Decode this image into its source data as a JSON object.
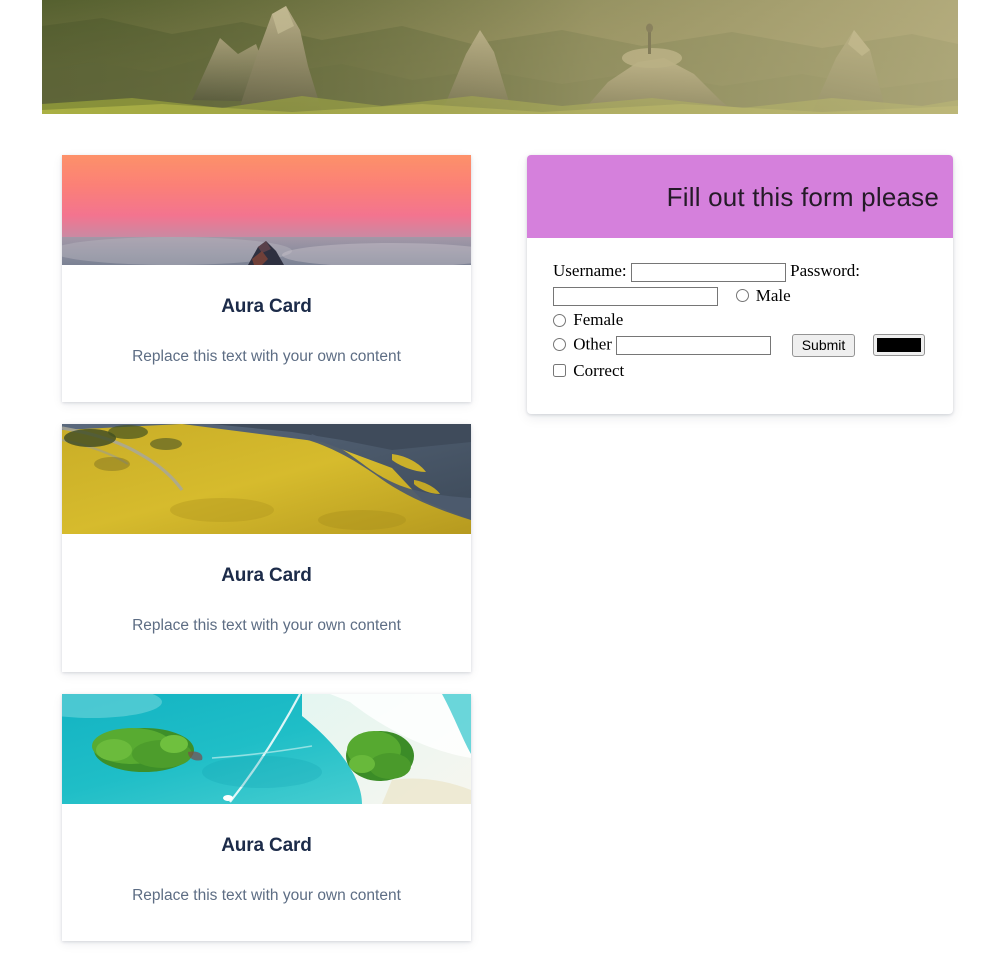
{
  "hero": {
    "alt": "mountain-landscape-banner",
    "palette": {
      "sky": "#8a8457",
      "forest": "#4f5a30",
      "rock_light": "#b3a882",
      "rock_dark": "#6a6348",
      "highlight": "#c9d14a"
    }
  },
  "cards": [
    {
      "title": "Aura Card",
      "text": "Replace this text with your own content",
      "image_name": "pink-sunset-peak-photo",
      "palette": {
        "top": "#fb8b6e",
        "mid": "#f4758f",
        "low": "#c98a9f",
        "bottom": "#6c7285",
        "accent": "#2f3242"
      }
    },
    {
      "title": "Aura Card",
      "text": "Replace this text with your own content",
      "image_name": "aerial-golden-grassland-river-photo",
      "palette": {
        "grass": "#d0b32a",
        "grass_dark": "#8a7c1e",
        "water": "#56657a",
        "water_dark": "#3d4a5c",
        "road": "#9a9a90"
      }
    },
    {
      "title": "Aura Card",
      "text": "Replace this text with your own content",
      "image_name": "turquoise-sea-islands-photo",
      "palette": {
        "sea": "#17b6c4",
        "sea_light": "#6fd7dd",
        "shallow": "#c9efe9",
        "sand": "#f3f4ef",
        "island": "#4fa832"
      }
    }
  ],
  "form": {
    "header_title": "Fill out this form please",
    "header_color": "#d580dc",
    "fields": {
      "username_label": "Username:",
      "username_value": "",
      "username_placeholder": "",
      "password_label": "Password:",
      "password_value": "",
      "password_placeholder": "",
      "other_value": "",
      "other_placeholder": ""
    },
    "radios": [
      {
        "label": "Male",
        "checked": false
      },
      {
        "label": "Female",
        "checked": false
      },
      {
        "label": "Other",
        "checked": false
      }
    ],
    "checkbox": {
      "label": "Correct",
      "checked": false
    },
    "submit_label": "Submit",
    "color_value": "#000000"
  }
}
